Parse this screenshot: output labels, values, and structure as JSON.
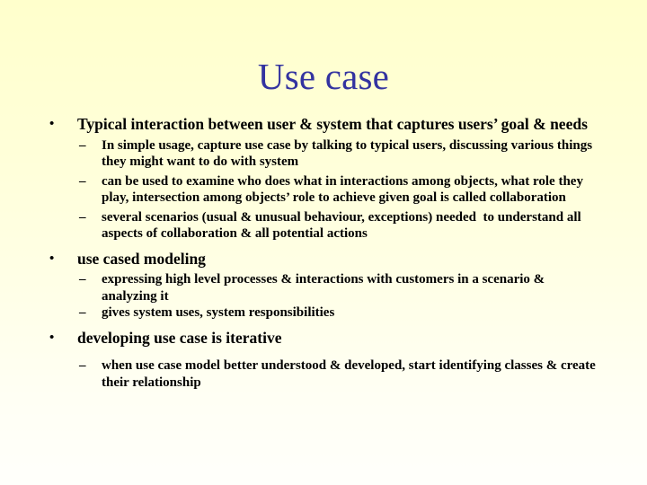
{
  "slide": {
    "title": "Use case",
    "title_color": "#3333a0",
    "text_color": "#000000",
    "background_top_color": "#ffffcc",
    "background_bottom_color": "#fffffb",
    "bullet_marker": "•",
    "dash_marker": "–",
    "content": [
      {
        "level": 1,
        "text": "Typical interaction between user & system that captures users’ goal & needs"
      },
      {
        "level": 2,
        "text": "In simple usage, capture use case by talking to typical users, discussing various things they might want to do with system"
      },
      {
        "level": 2,
        "text": "can be used to examine who does what in interactions among objects, what role they play, intersection among objects’ role to achieve given goal is called collaboration"
      },
      {
        "level": 2,
        "text": "several scenarios (usual & unusual behaviour, exceptions) needed  to understand all aspects of collaboration & all potential actions"
      },
      {
        "level": 1,
        "text": "use cased modeling"
      },
      {
        "level": 2,
        "text": "expressing high level processes & interactions with customers in a scenario & analyzing it"
      },
      {
        "level": 2,
        "text": "gives system uses, system responsibilities"
      },
      {
        "level": 1,
        "text": "developing use case is iterative"
      },
      {
        "level": 2,
        "text": "when use case model better understood & developed, start identifying classes & create their relationship"
      }
    ]
  }
}
